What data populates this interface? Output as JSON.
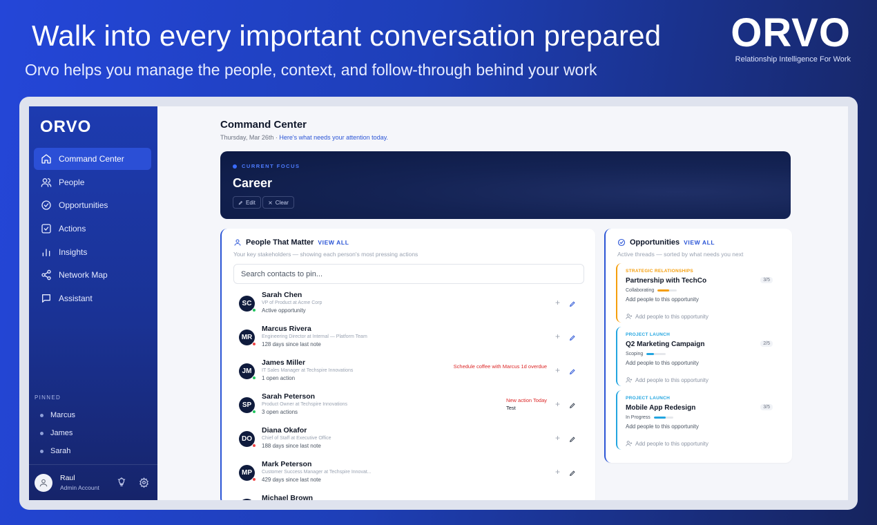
{
  "hero": {
    "title": "Walk into every important conversation prepared",
    "subtitle": "Orvo helps you manage the people, context, and follow-through behind your work",
    "brand": "ORVO",
    "tagline": "Relationship Intelligence For Work"
  },
  "sidebar": {
    "logo": "ORVO",
    "items": [
      {
        "label": "Command Center",
        "icon": "home-icon",
        "active": true
      },
      {
        "label": "People",
        "icon": "people-icon"
      },
      {
        "label": "Opportunities",
        "icon": "check-circle-icon"
      },
      {
        "label": "Actions",
        "icon": "checkbox-icon"
      },
      {
        "label": "Insights",
        "icon": "bar-chart-icon"
      },
      {
        "label": "Network Map",
        "icon": "share-icon"
      },
      {
        "label": "Assistant",
        "icon": "chat-icon"
      }
    ],
    "pinned_label": "PINNED",
    "pinned": [
      "Marcus",
      "James",
      "Sarah"
    ],
    "user": {
      "name": "Raul",
      "role": "Admin Account"
    }
  },
  "main": {
    "title": "Command Center",
    "date": "Thursday, Mar 26th ·",
    "date_link": "Here's what needs your attention today.",
    "focus": {
      "label": "CURRENT FOCUS",
      "title": "Career",
      "edit_label": "Edit",
      "clear_label": "Clear"
    },
    "people": {
      "title": "People That Matter",
      "view_all": "VIEW ALL",
      "subtitle": "Your key stakeholders — showing each person's most pressing actions",
      "search_placeholder": "Search contacts to pin...",
      "list": [
        {
          "initials": "SC",
          "name": "Sarah Chen",
          "role": "VP of Product at Acme Corp",
          "note": "Active opportunity",
          "status": "#22c55e",
          "action": "",
          "action_sub": "",
          "edit_color": "#2b55d6"
        },
        {
          "initials": "MR",
          "name": "Marcus Rivera",
          "role": "Engineering Director at Internal — Platform Team",
          "note": "128 days since last note",
          "status": "#ef4444",
          "action": "",
          "action_sub": "",
          "edit_color": "#2b55d6"
        },
        {
          "initials": "JM",
          "name": "James Miller",
          "role": "IT Sales Manager at Techspire Innovations",
          "note": "1 open action",
          "status": "#22c55e",
          "action": "Schedule coffee with Marcus  1d overdue",
          "action_sub": "",
          "edit_color": "#2b55d6"
        },
        {
          "initials": "SP",
          "name": "Sarah Peterson",
          "role": "Product Owner at Techspire Innovations",
          "note": "3 open actions",
          "status": "#22c55e",
          "action": "New action  Today",
          "action_sub": "Test",
          "edit_color": "#374151"
        },
        {
          "initials": "DO",
          "name": "Diana Okafor",
          "role": "Chief of Staff at Executive Office",
          "note": "188 days since last note",
          "status": "#ef4444",
          "action": "",
          "action_sub": "",
          "edit_color": "#374151"
        },
        {
          "initials": "MP",
          "name": "Mark Peterson",
          "role": "Customer Success Manager at Techspire Innovat...",
          "note": "429 days since last note",
          "status": "#ef4444",
          "action": "",
          "action_sub": "",
          "edit_color": "#374151"
        },
        {
          "initials": "MB",
          "name": "Michael Brown",
          "role": "",
          "note": "",
          "status": "#22c55e",
          "action": "",
          "action_sub": "",
          "edit_color": "#374151"
        }
      ]
    },
    "opportunities": {
      "title": "Opportunities",
      "view_all": "VIEW ALL",
      "subtitle": "Active threads — sorted by what needs you next",
      "list": [
        {
          "tag": "STRATEGIC RELATIONSHIPS",
          "title": "Partnership with TechCo",
          "count": "3/5",
          "stage": "Collaborating",
          "progress": 0.6,
          "bar_color": "#f59e0b",
          "help": "Add people to this opportunity",
          "add": "Add people to this opportunity",
          "tone": "orange"
        },
        {
          "tag": "PROJECT LAUNCH",
          "title": "Q2 Marketing Campaign",
          "count": "2/5",
          "stage": "Scoping",
          "progress": 0.4,
          "bar_color": "#22a5e0",
          "help": "Add people to this opportunity",
          "add": "Add people to this opportunity",
          "tone": "blue"
        },
        {
          "tag": "PROJECT LAUNCH",
          "title": "Mobile App Redesign",
          "count": "3/5",
          "stage": "In Progress",
          "progress": 0.6,
          "bar_color": "#22a5e0",
          "help": "Add people to this opportunity",
          "add": "Add people to this opportunity",
          "tone": "blue"
        }
      ]
    }
  }
}
